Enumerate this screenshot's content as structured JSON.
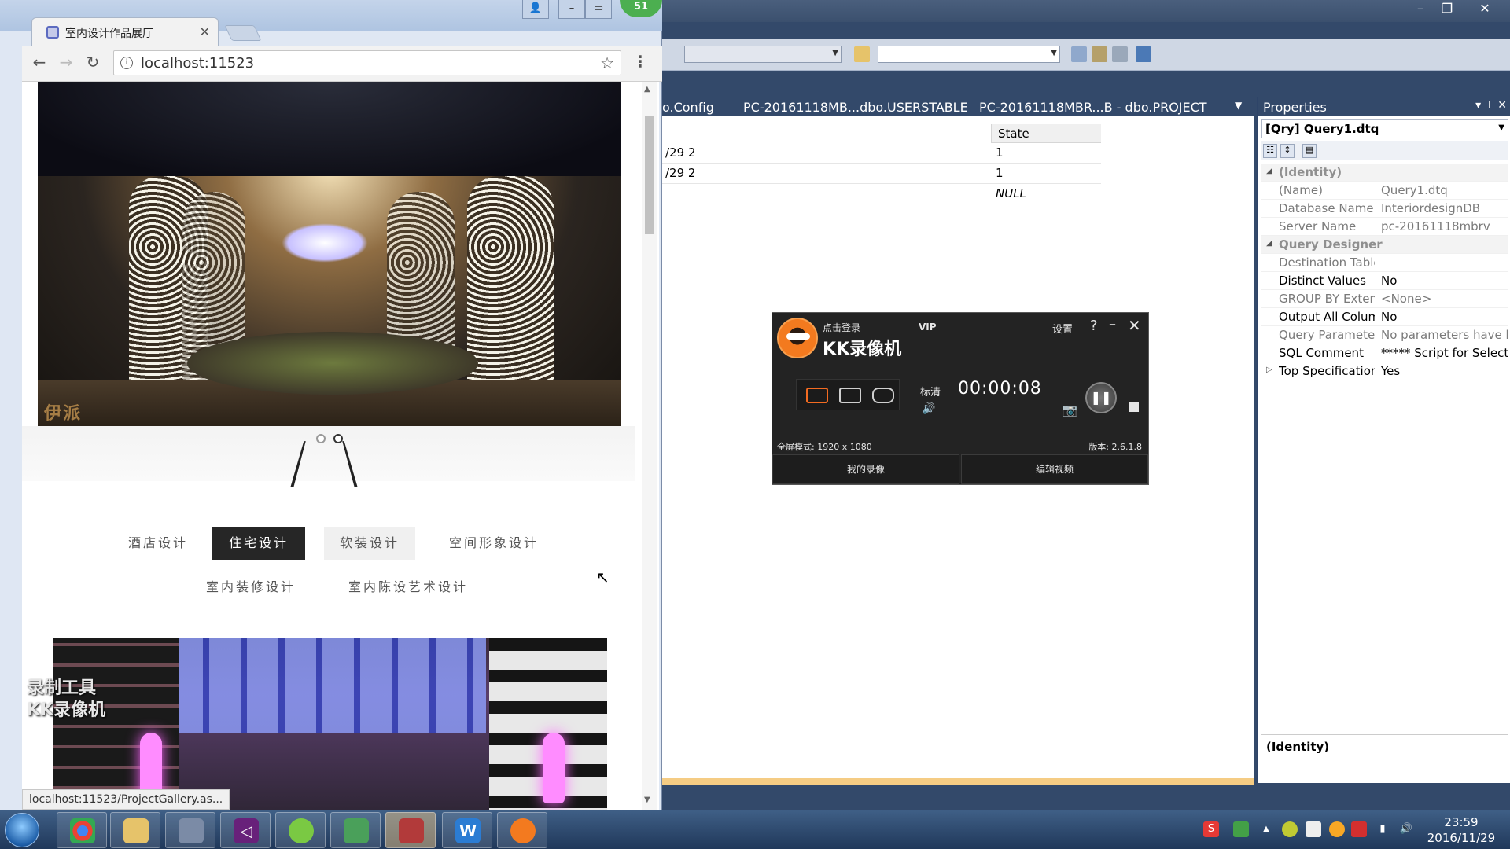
{
  "vs": {
    "doc_tabs": [
      "o.Config",
      "PC-20161118MB...dbo.USERSTABLE",
      "PC-20161118MBR...B - dbo.PROJECT"
    ],
    "grid": {
      "header": "State",
      "left_values": [
        "/29 2",
        "/29 2"
      ],
      "state_values": [
        "1",
        "1",
        "NULL"
      ]
    },
    "properties": {
      "title": "Properties",
      "object": "[Qry] Query1.dtq",
      "rows": [
        {
          "key": "(Identity)",
          "value": "",
          "cat": true
        },
        {
          "key": "(Name)",
          "value": "Query1.dtq",
          "dim": true
        },
        {
          "key": "Database Name",
          "value": "InteriordesignDB",
          "dim": true
        },
        {
          "key": "Server Name",
          "value": "pc-20161118mbrv",
          "dim": true
        },
        {
          "key": "Query Designer",
          "value": "",
          "cat": true
        },
        {
          "key": "Destination Table",
          "value": "",
          "dim": true
        },
        {
          "key": "Distinct Values",
          "value": "No"
        },
        {
          "key": "GROUP BY Extension",
          "value": "<None>",
          "dim": true
        },
        {
          "key": "Output All Columns",
          "value": "No"
        },
        {
          "key": "Query Parameter List",
          "value": "No parameters have been",
          "dim": true
        },
        {
          "key": "SQL Comment",
          "value": "***** Script for Select",
          "bold": true
        },
        {
          "key": "Top Specification",
          "value": "Yes"
        }
      ],
      "description": "(Identity)"
    }
  },
  "chrome": {
    "tab_title": "室内设计作品展厅",
    "url": "localhost:11523",
    "badge": "51",
    "categories_row1": [
      "酒店设计",
      "住宅设计",
      "软装设计",
      "空间形象设计"
    ],
    "categories_row2": [
      "室内装修设计",
      "室内陈设艺术设计"
    ],
    "hero_watermark": "伊派",
    "status_link": "localhost:11523/ProjectGallery.as...",
    "kk_watermark_line1": "录制工具",
    "kk_watermark_line2": "KK录像机"
  },
  "kk": {
    "login": "点击登录",
    "vip": "VIP",
    "brand": "KK录像机",
    "settings": "设置",
    "help": "?",
    "minimize": "–",
    "close": "✕",
    "quality": "标清",
    "time": "00:00:08",
    "mode_info": "全屏模式: 1920 x 1080",
    "version": "版本: 2.6.1.8",
    "my_recordings": "我的录像",
    "edit_video": "编辑视频"
  },
  "taskbar": {
    "time": "23:59",
    "date": "2016/11/29"
  }
}
